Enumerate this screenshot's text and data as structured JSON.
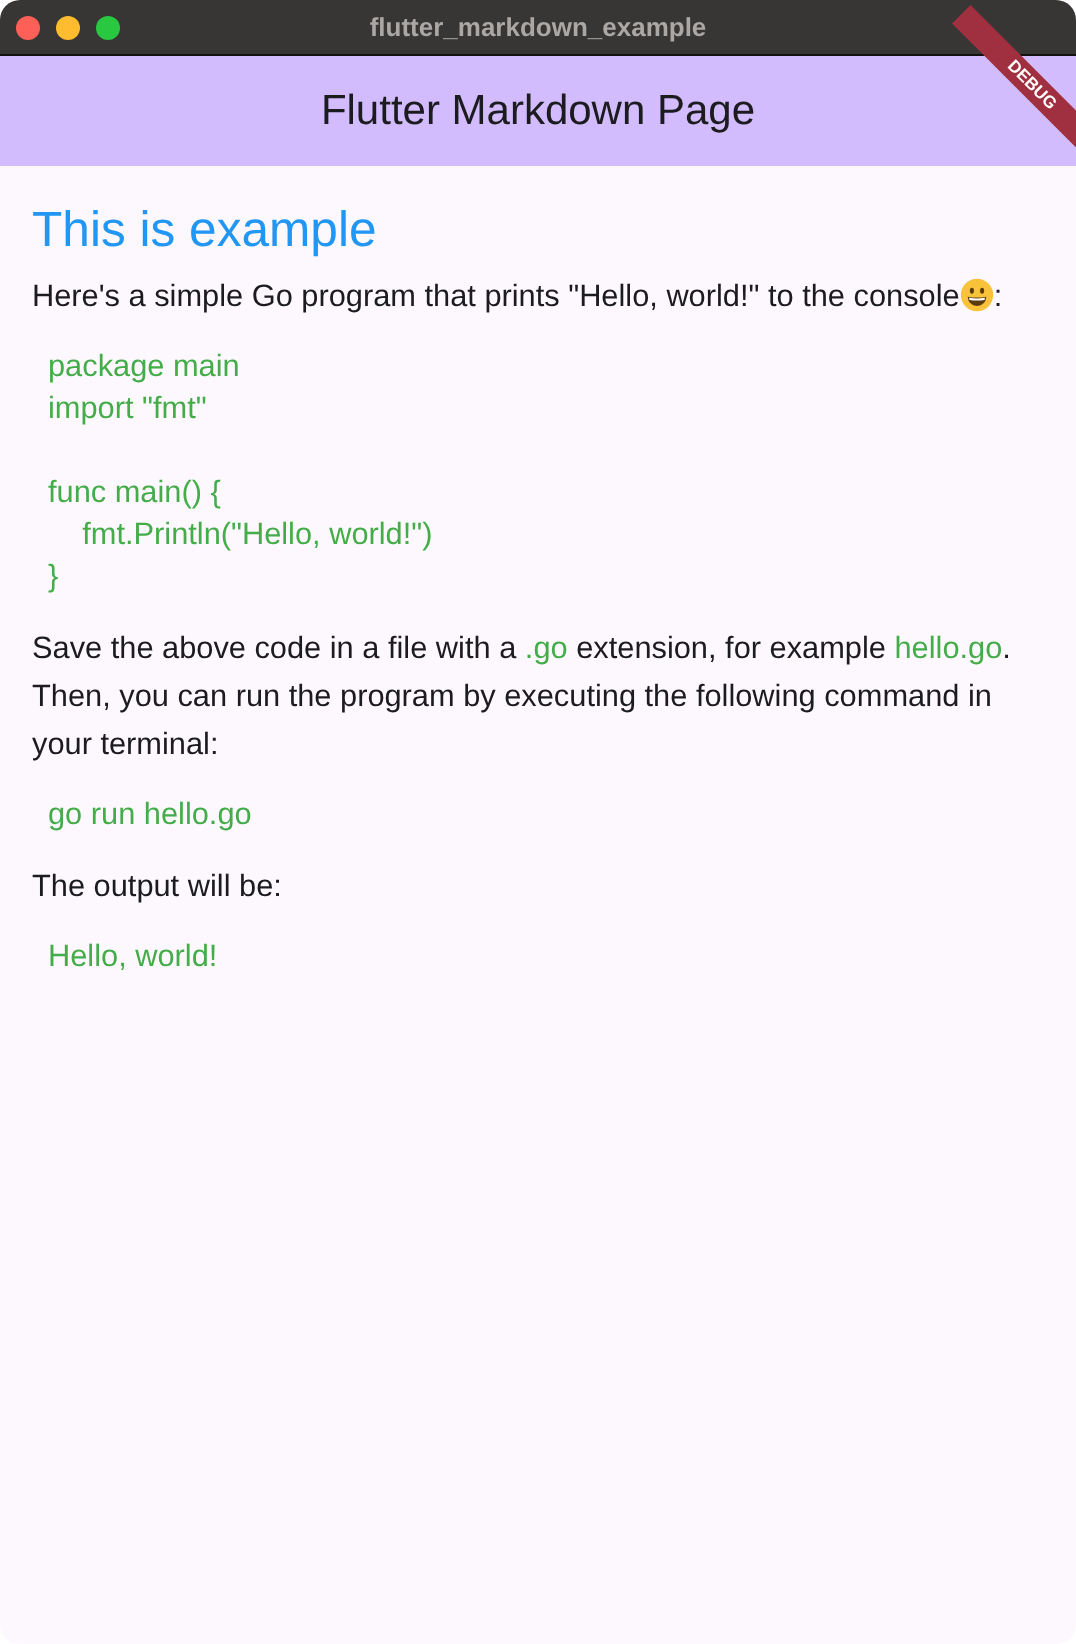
{
  "window": {
    "title": "flutter_markdown_example"
  },
  "app_bar": {
    "title": "Flutter Markdown Page",
    "debug_banner": "DEBUG"
  },
  "content": [
    {
      "kind": "heading",
      "text": "This is example"
    },
    {
      "kind": "paragraph",
      "segments": [
        {
          "kind": "text",
          "text": "Here's a simple Go program that prints \"Hello, world!\" to the console"
        },
        {
          "kind": "emoji"
        },
        {
          "kind": "text",
          "text": ":"
        }
      ]
    },
    {
      "kind": "code",
      "text": "package main\nimport \"fmt\"\n\nfunc main() {\n    fmt.Println(\"Hello, world!\")\n}"
    },
    {
      "kind": "paragraph",
      "segments": [
        {
          "kind": "text",
          "text": "Save the above code in a file with a "
        },
        {
          "kind": "code",
          "text": ".go"
        },
        {
          "kind": "text",
          "text": " extension, for example "
        },
        {
          "kind": "code",
          "text": "hello.go"
        },
        {
          "kind": "text",
          "text": ". Then, you can run the program by executing the following command in your terminal:"
        }
      ]
    },
    {
      "kind": "code",
      "text": "go run hello.go"
    },
    {
      "kind": "paragraph",
      "segments": [
        {
          "kind": "text",
          "text": "The output will be:"
        }
      ]
    },
    {
      "kind": "code",
      "text": "Hello, world!"
    }
  ]
}
